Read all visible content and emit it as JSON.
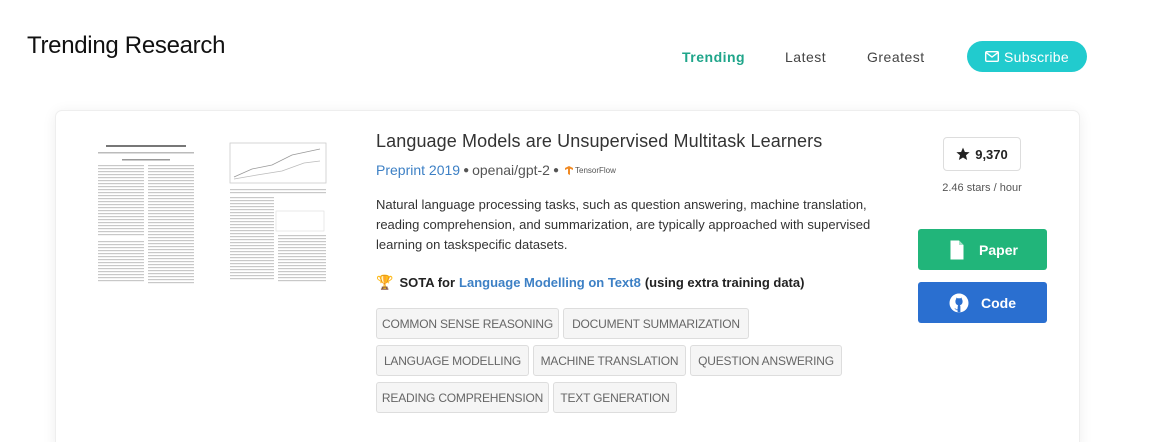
{
  "header": {
    "title": "Trending Research",
    "tabs": [
      {
        "label": "Trending",
        "active": true
      },
      {
        "label": "Latest",
        "active": false
      },
      {
        "label": "Greatest",
        "active": false
      }
    ],
    "subscribe_label": "Subscribe",
    "subscribe_icon": "envelope-icon"
  },
  "paper": {
    "title": "Language Models are Unsupervised Multitask Learners",
    "conference": "Preprint 2019",
    "repo": "openai/gpt-2",
    "framework": "TensorFlow",
    "abstract": "Natural language processing tasks, such as question answering, machine translation, reading comprehension, and summarization, are typically approached with supervised learning on taskspecific datasets.",
    "sota": {
      "prefix": "SOTA for",
      "task": "Language Modelling on Text8",
      "suffix": "(using extra training data)"
    },
    "tags": [
      "COMMON SENSE REASONING",
      "DOCUMENT SUMMARIZATION",
      "LANGUAGE MODELLING",
      "MACHINE TRANSLATION",
      "QUESTION ANSWERING",
      "READING COMPREHENSION",
      "TEXT GENERATION"
    ],
    "stars": "9,370",
    "stars_rate": "2.46 stars / hour",
    "paper_button": "Paper",
    "code_button": "Code"
  },
  "colors": {
    "accent": "#21cbce",
    "trending": "#1fa58a",
    "paper_button": "#21b57a",
    "code_button": "#2a6fd0",
    "link": "#3d80c5"
  }
}
